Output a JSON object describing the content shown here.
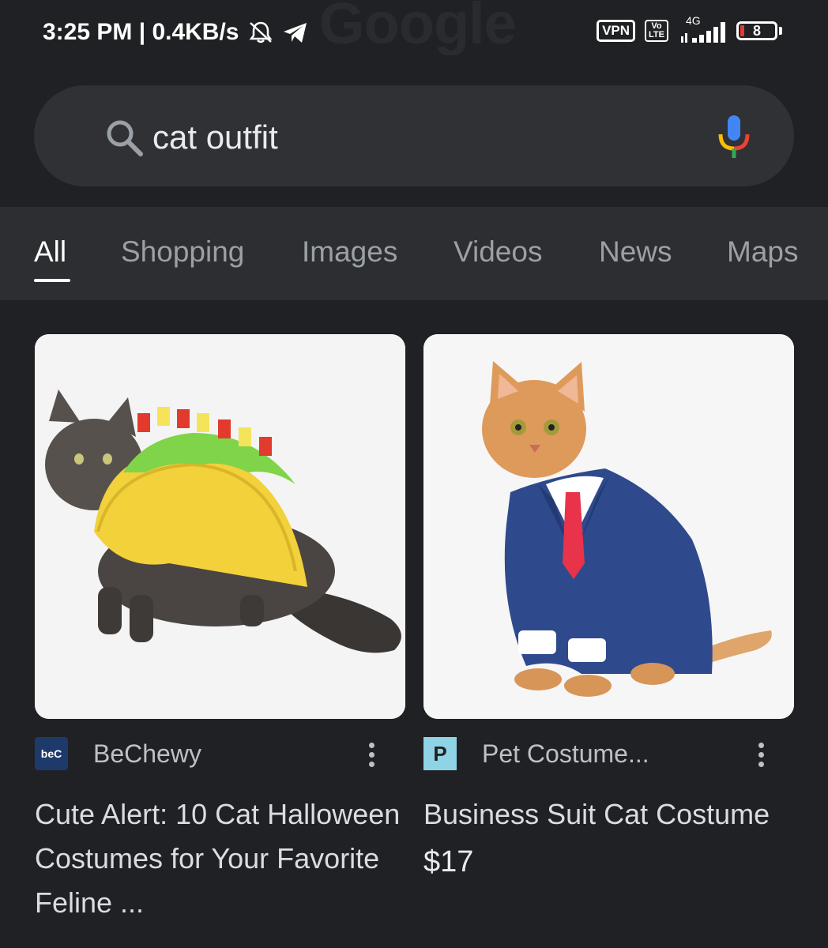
{
  "status_bar": {
    "time_speed": "3:25 PM | 0.4KB/s",
    "vpn": "VPN",
    "volte_top": "Vo",
    "volte_bottom": "LTE",
    "network": "4G",
    "battery": "8"
  },
  "background_logo": "Google",
  "search": {
    "query": "cat outfit"
  },
  "tabs": [
    {
      "label": "All",
      "active": true
    },
    {
      "label": "Shopping",
      "active": false
    },
    {
      "label": "Images",
      "active": false
    },
    {
      "label": "Videos",
      "active": false
    },
    {
      "label": "News",
      "active": false
    },
    {
      "label": "Maps",
      "active": false
    }
  ],
  "results": [
    {
      "source": "BeChewy",
      "favicon_text": "beC",
      "title": "Cute Alert: 10 Cat Halloween Costumes for Your Favorite Feline ..."
    },
    {
      "source": "Pet Costume...",
      "favicon_text": "P",
      "title": "Business Suit Cat Costume",
      "price": "$17"
    }
  ]
}
